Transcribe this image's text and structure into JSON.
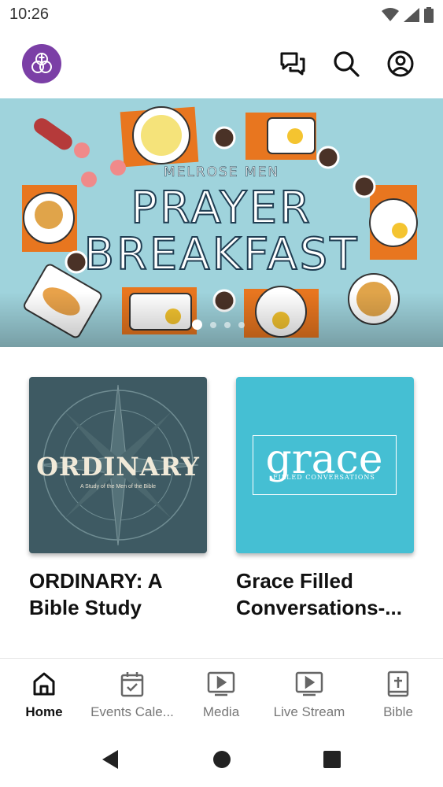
{
  "status_bar": {
    "time": "10:26",
    "icons": [
      "wifi-icon",
      "signal-icon",
      "battery-icon"
    ]
  },
  "header": {
    "logo": "church-logo",
    "actions": [
      "chat-icon",
      "search-icon",
      "account-icon"
    ]
  },
  "banner": {
    "subtitle": "MELROSE MEN",
    "title_line1": "PRAYER",
    "title_line2": "BREAKFAST",
    "page_count": 4,
    "active_page": 1,
    "background_color": "#9fd3dc"
  },
  "cards": [
    {
      "title": "ORDINARY: A Bible Study",
      "image_word": "ORDINARY",
      "image_sub": "A Study of the Men of the Bible"
    },
    {
      "title": "Grace Filled Conversations-...",
      "image_word": "grace",
      "image_sub": "FILLED CONVERSATIONS"
    }
  ],
  "bottom_nav": {
    "items": [
      {
        "label": "Home",
        "icon": "home-icon",
        "active": true
      },
      {
        "label": "Events Cale...",
        "icon": "calendar-icon",
        "active": false
      },
      {
        "label": "Media",
        "icon": "play-screen-icon",
        "active": false
      },
      {
        "label": "Live Stream",
        "icon": "play-screen-icon",
        "active": false
      },
      {
        "label": "Bible",
        "icon": "bible-icon",
        "active": false
      }
    ]
  },
  "colors": {
    "accent": "#7b3fa6",
    "grace_card": "#45bfd3",
    "ordinary_card": "#3e5a63"
  }
}
